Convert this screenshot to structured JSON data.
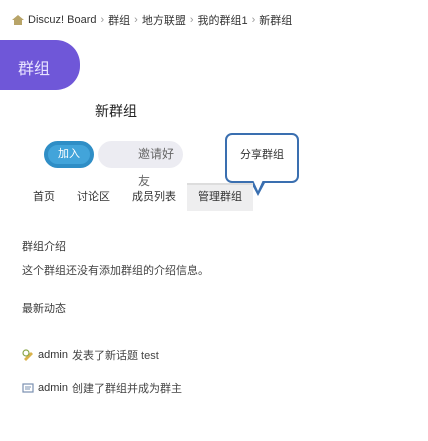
{
  "breadcrumb": {
    "items": [
      "Discuz! Board",
      "群组",
      "地方联盟",
      "我的群组1",
      "新群组"
    ],
    "separator": "›"
  },
  "group_tab": {
    "label": "群组"
  },
  "group": {
    "name": "新群组"
  },
  "actions": {
    "join_label": "加入",
    "share_label": "邀请好友",
    "bubble_text": "分享群组"
  },
  "tabs": [
    {
      "label": "首页",
      "active": false
    },
    {
      "label": "讨论区",
      "active": false
    },
    {
      "label": "成员列表",
      "active": false
    },
    {
      "label": "管理群组",
      "active": true
    }
  ],
  "intro": {
    "title": "群组介绍",
    "text": "这个群组还没有添加群组的介绍信息。"
  },
  "activity": {
    "title": "最新动态",
    "items": [
      {
        "icon": "thread-icon",
        "actor": "admin",
        "text": "发表了新话题 test"
      },
      {
        "icon": "join-icon",
        "actor": "admin",
        "text": "创建了群组并成为群主"
      }
    ]
  },
  "colors": {
    "tab_purple": "#6f57d8",
    "join_blue": "#42a4da",
    "bubble_border": "#3a6fb0"
  }
}
